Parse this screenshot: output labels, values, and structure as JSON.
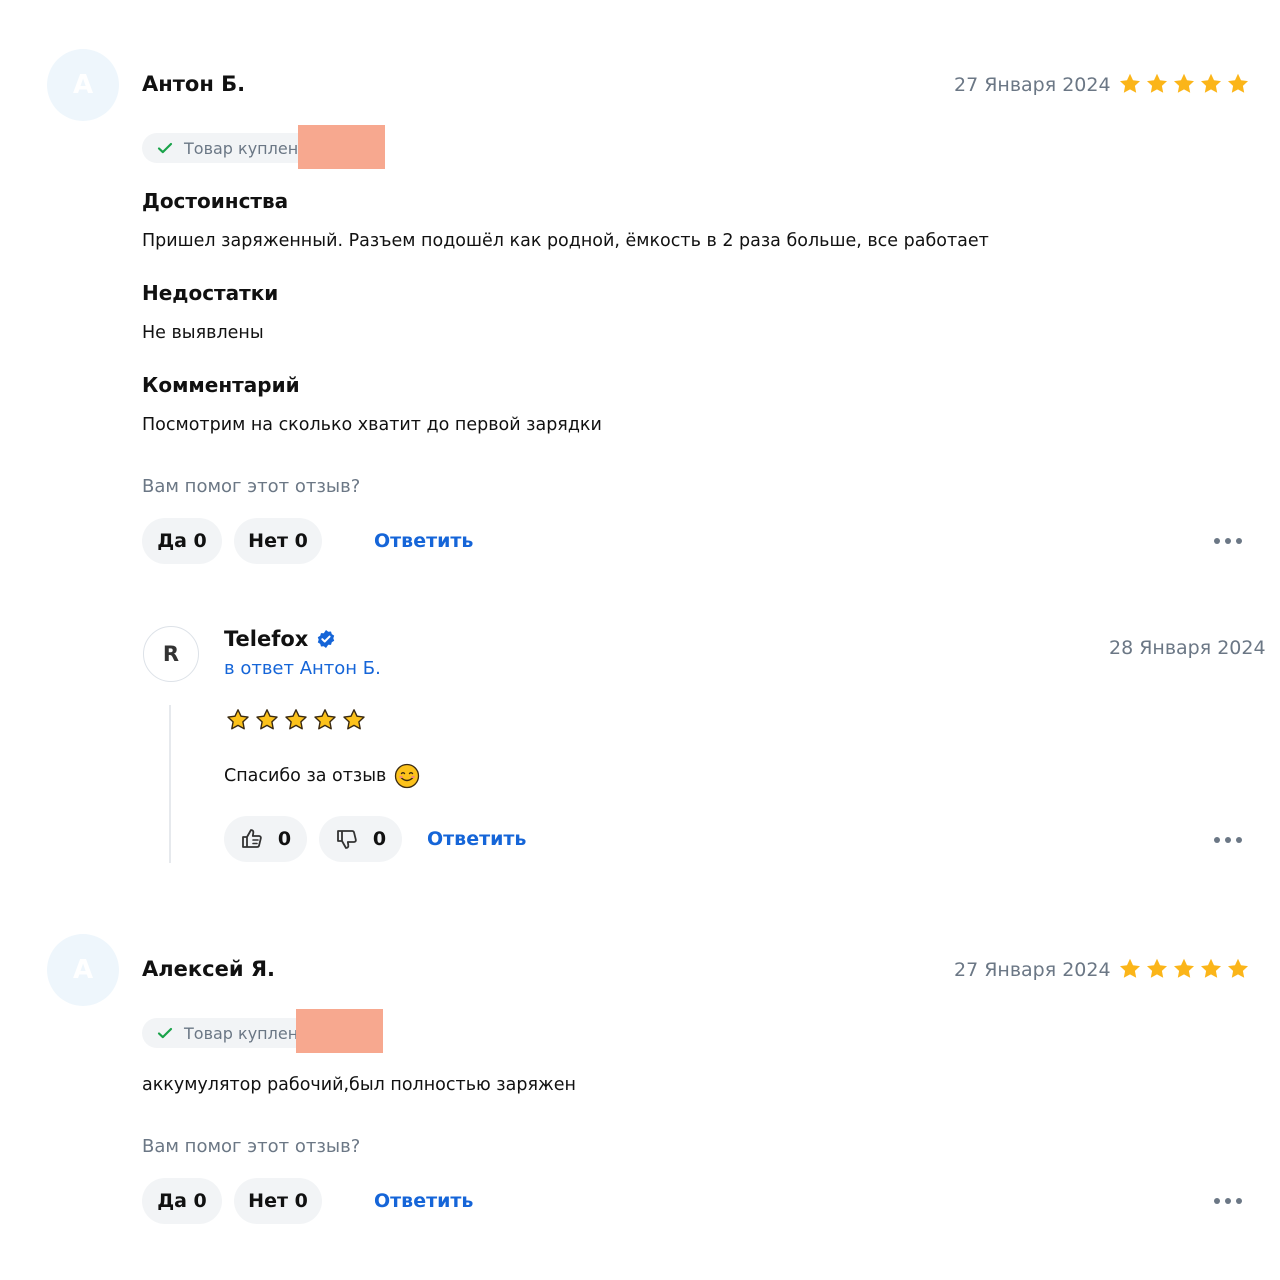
{
  "reviews": [
    {
      "avatar_letter": "А",
      "author": "Антон Б.",
      "date": "27 Января 2024",
      "rating": 5,
      "purchase_badge": "Товар куплен в",
      "sections": [
        {
          "title": "Достоинства",
          "text": "Пришел заряженный. Разъем подошёл как родной, ёмкость в 2 раза больше, все работает"
        },
        {
          "title": "Недостатки",
          "text": "Не выявлены"
        },
        {
          "title": "Комментарий",
          "text": "Посмотрим на сколько хватит до первой зарядки"
        }
      ],
      "helpful_question": "Вам помог этот отзыв?",
      "yes_label": "Да 0",
      "no_label": "Нет 0",
      "reply_label": "Ответить",
      "reply": {
        "avatar_letter": "R",
        "author": "Telefox",
        "in_reply_to": "в ответ Антон Б.",
        "date": "28 Января 2024",
        "star_icons": 5,
        "text": "Спасибо за отзыв",
        "emoji": "smiling-face-icon",
        "likes": "0",
        "dislikes": "0",
        "reply_label": "Ответить"
      }
    },
    {
      "avatar_letter": "А",
      "author": "Алексей Я.",
      "date": "27 Января 2024",
      "rating": 5,
      "purchase_badge": "Товар куплен",
      "text": "аккумулятор рабочий,был полностью заряжен",
      "helpful_question": "Вам помог этот отзыв?",
      "yes_label": "Да 0",
      "no_label": "Нет 0",
      "reply_label": "Ответить"
    }
  ],
  "colors": {
    "star": "#fbb519",
    "link": "#1565d8",
    "muted": "#6b7785",
    "pill_bg": "#f2f4f6",
    "check": "#1aa34a",
    "verified": "#1565d8",
    "redaction": "#f7a88f"
  }
}
